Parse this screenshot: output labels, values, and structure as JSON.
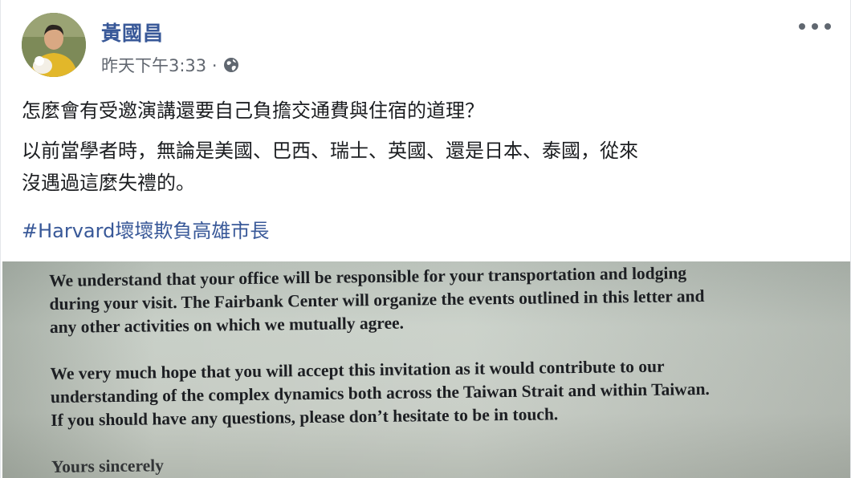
{
  "post": {
    "author": "黃國昌",
    "timestamp": "昨天下午3:33 ·",
    "privacy_icon": "globe-icon",
    "more_icon": "more-options-icon",
    "text_paragraphs": [
      "怎麼會有受邀演講還要自己負擔交通費與住宿的道理？",
      "以前當學者時，無論是美國、巴西、瑞士、英國、還是日本、泰國，從來\n沒遇過這麼失禮的。"
    ],
    "hashtag": "#Harvard壞壞欺負高雄市長"
  },
  "photo": {
    "paragraphs": [
      {
        "lines": [
          "We understand that your office will be responsible for your transportation and lodging",
          "during your visit. The Fairbank Center will organize the events outlined in this letter and",
          "any other activities on which we mutually agree."
        ]
      },
      {
        "lines": [
          "We very much hope that you will accept this invitation as it would contribute to our",
          "understanding of the complex dynamics both across the Taiwan Strait and within Taiwan.",
          "If you should have any questions, please don’t hesitate to be in touch."
        ]
      }
    ],
    "closing": "Yours sincerely"
  },
  "colors": {
    "link": "#385898",
    "text": "#1c1e21",
    "meta": "#616770"
  }
}
